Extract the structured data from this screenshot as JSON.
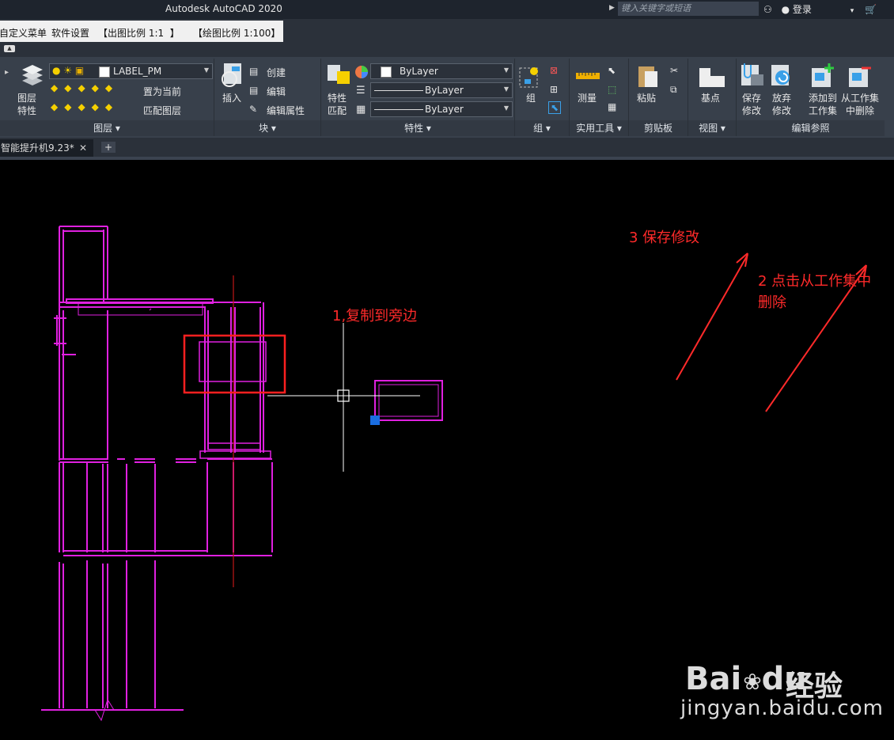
{
  "window": {
    "title": "Autodesk AutoCAD 2020",
    "search_placeholder": "键入关键字或短语",
    "login_label": "登录"
  },
  "menubar": {
    "items": [
      "自定义菜单",
      "软件设置",
      "【出图比例 1:1  】",
      "【绘图比例 1:100】"
    ]
  },
  "ribbon": {
    "layers": {
      "layer_props_label": "图层\n特性",
      "current_layer": "LABEL_PM",
      "set_current_label": "置为当前",
      "match_layer_label": "匹配图层",
      "panel_title": "图层 ▾"
    },
    "block": {
      "insert_label": "插入",
      "create_label": "创建",
      "edit_label": "编辑",
      "edit_attr_label": "编辑属性",
      "panel_title": "块 ▾"
    },
    "properties": {
      "match_label": "特性\n匹配",
      "color_value": "ByLayer",
      "linetype_value": "ByLayer",
      "lineweight_value": "ByLayer",
      "panel_title": "特性 ▾"
    },
    "group": {
      "group_label": "组",
      "panel_title": "组 ▾"
    },
    "utilities": {
      "measure_label": "测量",
      "panel_title": "实用工具 ▾"
    },
    "clipboard": {
      "paste_label": "粘贴",
      "panel_title": "剪贴板"
    },
    "view": {
      "basepoint_label": "基点",
      "panel_title": "视图 ▾"
    },
    "xref_edit": {
      "save_changes_label": "保存\n修改",
      "discard_changes_label": "放弃\n修改",
      "add_to_set_label": "添加到\n工作集",
      "remove_from_set_label": "从工作集\n中删除",
      "panel_title": "编辑参照"
    }
  },
  "tabs": {
    "active": "智能提升机9.23*"
  },
  "annotations": {
    "step1": "1,复制到旁边",
    "step2_line1": "2 点击从工作集中",
    "step2_line2": "删除",
    "step3": "3 保存修改"
  },
  "watermark": {
    "brand": "Bai",
    "brand2": "du",
    "cn": "经验",
    "url": "jingyan.baidu.com"
  },
  "colors": {
    "accent_red": "#ff2a2a",
    "cad_magenta": "#e020e0",
    "ribbon_bg": "#38404b"
  }
}
